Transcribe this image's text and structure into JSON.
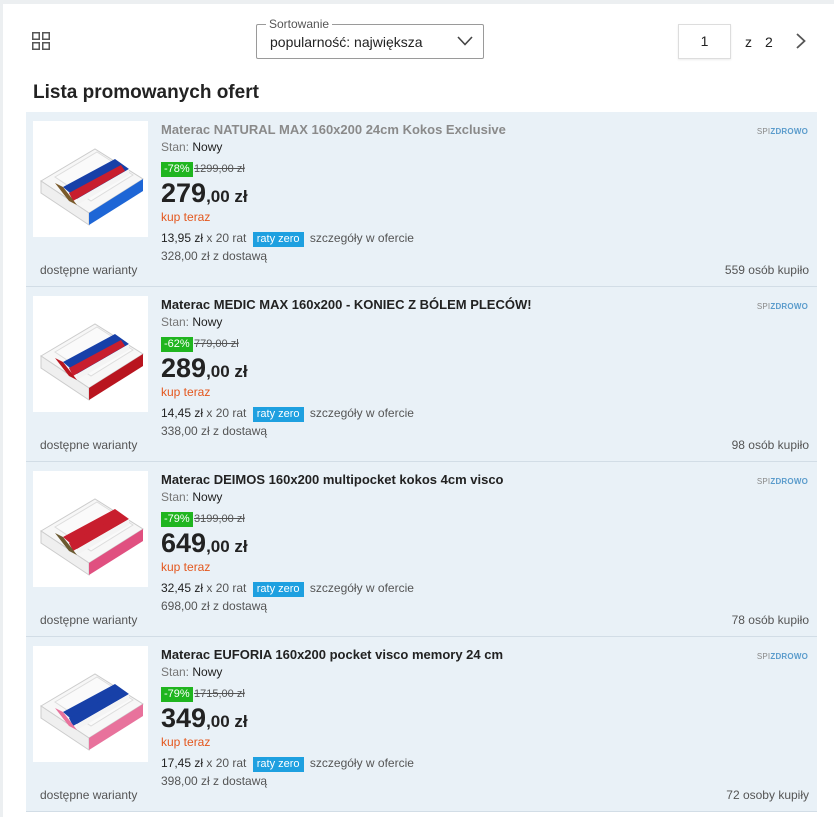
{
  "toolbar": {
    "view_icon": "grid-view-icon",
    "sort_label": "Sortowanie",
    "sort_value": "popularność: największa",
    "page_current": "1",
    "page_of": "z",
    "page_total": "2",
    "next_icon": "chevron-right-icon"
  },
  "list_title": "Lista promowanych ofert",
  "offers": [
    {
      "title": "Materac NATURAL MAX 160x200 24cm Kokos Exclusive",
      "state_label": "Stan:",
      "state_value": "Nowy",
      "discount": "-78%",
      "old_price": "1299,00 zł",
      "price_main": "279",
      "price_fraction": ",00 zł",
      "buy_now": "kup teraz",
      "installment_amount": "13,95 zł",
      "installment_count": "x 20 rat",
      "installment_badge": "raty zero",
      "installment_details": "szczegóły w ofercie",
      "delivery": "328,00 zł z dostawą",
      "variants": "dostępne warianty",
      "sold": "559 osób kupiło",
      "brand_prefix": "SPI",
      "brand_name": "ZDROWO"
    },
    {
      "title": "Materac MEDIC MAX 160x200 - KONIEC Z BÓLEM PLECÓW!",
      "state_label": "Stan:",
      "state_value": "Nowy",
      "discount": "-62%",
      "old_price": "779,00 zł",
      "price_main": "289",
      "price_fraction": ",00 zł",
      "buy_now": "kup teraz",
      "installment_amount": "14,45 zł",
      "installment_count": "x 20 rat",
      "installment_badge": "raty zero",
      "installment_details": "szczegóły w ofercie",
      "delivery": "338,00 zł z dostawą",
      "variants": "dostępne warianty",
      "sold": "98 osób kupiło",
      "brand_prefix": "SPI",
      "brand_name": "ZDROWO"
    },
    {
      "title": "Materac DEIMOS 160x200 multipocket kokos 4cm visco",
      "state_label": "Stan:",
      "state_value": "Nowy",
      "discount": "-79%",
      "old_price": "3199,00 zł",
      "price_main": "649",
      "price_fraction": ",00 zł",
      "buy_now": "kup teraz",
      "installment_amount": "32,45 zł",
      "installment_count": "x 20 rat",
      "installment_badge": "raty zero",
      "installment_details": "szczegóły w ofercie",
      "delivery": "698,00 zł z dostawą",
      "variants": "dostępne warianty",
      "sold": "78 osób kupiło",
      "brand_prefix": "SPI",
      "brand_name": "ZDROWO"
    },
    {
      "title": "Materac EUFORIA 160x200 pocket visco memory 24 cm",
      "state_label": "Stan:",
      "state_value": "Nowy",
      "discount": "-79%",
      "old_price": "1715,00 zł",
      "price_main": "349",
      "price_fraction": ",00 zł",
      "buy_now": "kup teraz",
      "installment_amount": "17,45 zł",
      "installment_count": "x 20 rat",
      "installment_badge": "raty zero",
      "installment_details": "szczegóły w ofercie",
      "delivery": "398,00 zł z dostawą",
      "variants": "dostępne warianty",
      "sold": "72 osoby kupiły",
      "brand_prefix": "SPI",
      "brand_name": "ZDROWO"
    }
  ],
  "colors": {
    "accent_orange": "#e4571d",
    "discount_green": "#1fb51f",
    "raty_blue": "#1ea0e0",
    "offer_bg": "#e9f1f7"
  }
}
